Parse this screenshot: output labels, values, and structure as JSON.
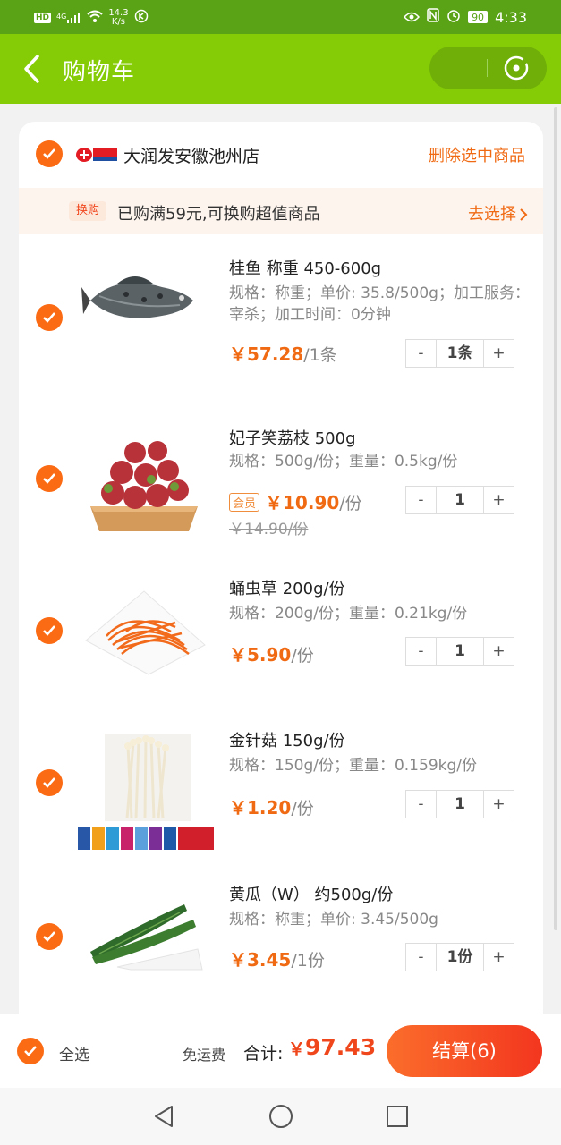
{
  "status_bar": {
    "network_speed": "14.3",
    "network_unit": "K/s",
    "battery": "90",
    "time": "4:33",
    "hd": "HD",
    "signal": "4G"
  },
  "header": {
    "title": "购物车"
  },
  "store": {
    "name": "大润发安徽池州店",
    "logo_text": "大润发",
    "delete_selected": "删除选中商品"
  },
  "promo": {
    "tag": "换购",
    "text": "已购满59元,可换购超值商品",
    "action": "去选择"
  },
  "items": [
    {
      "name": "桂鱼 称重 450-600g",
      "spec": "规格：称重；单价: 35.8/500g；加工服务：宰杀；加工时间：0分钟",
      "price": "￥57.28",
      "unit": "/1条",
      "qty": "1条",
      "minus": "-",
      "plus": "+"
    },
    {
      "name": "妃子笑荔枝 500g",
      "spec": "规格：500g/份；重量：0.5kg/份",
      "member_tag": "会员",
      "price": "￥10.90",
      "unit": "/份",
      "old_price": "￥14.90/份",
      "qty": "1",
      "minus": "-",
      "plus": "+"
    },
    {
      "name": "蛹虫草 200g/份",
      "spec": "规格：200g/份；重量：0.21kg/份",
      "price": "￥5.90",
      "unit": "/份",
      "qty": "1",
      "minus": "-",
      "plus": "+"
    },
    {
      "name": "金针菇 150g/份",
      "spec": "规格：150g/份；重量：0.159kg/份",
      "price": "￥1.20",
      "unit": "/份",
      "qty": "1",
      "minus": "-",
      "plus": "+"
    },
    {
      "name": "黄瓜（W） 约500g/份",
      "spec": "规格：称重；单价: 3.45/500g",
      "price": "￥3.45",
      "unit": "/1份",
      "qty": "1份",
      "minus": "-",
      "plus": "+"
    }
  ],
  "bottom": {
    "select_all": "全选",
    "shipping": "免运费",
    "total_label": "合计:",
    "currency": "￥",
    "total": "97.43",
    "checkout": "结算(6)"
  },
  "colors": {
    "header": "#86cc06",
    "status": "#5aa317",
    "accent": "#f06a13",
    "checkout": "#f3361f"
  }
}
